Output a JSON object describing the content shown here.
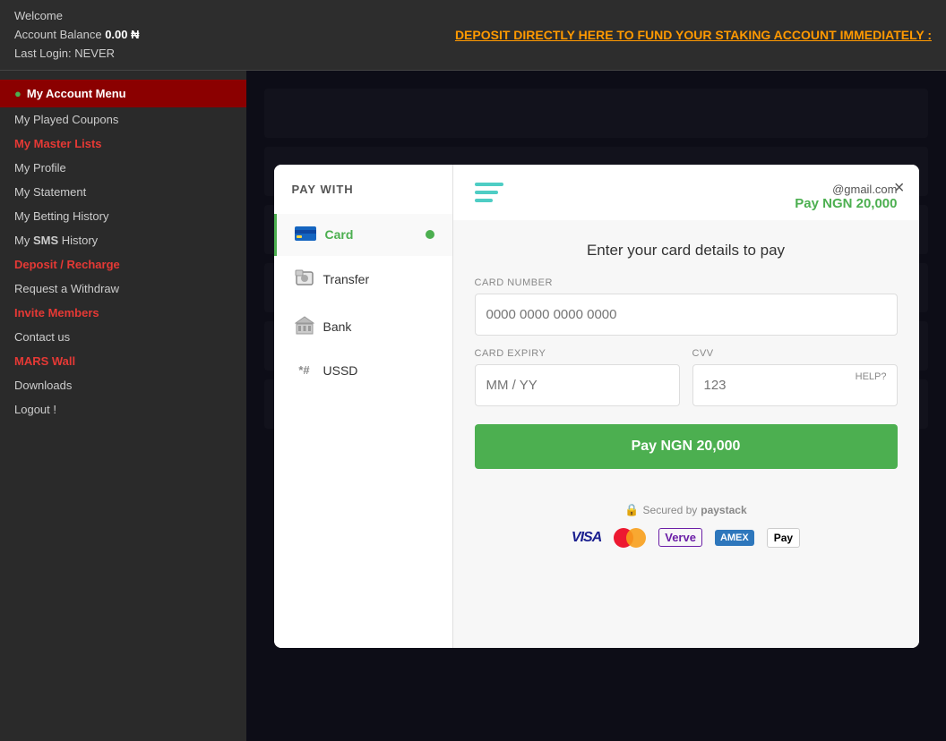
{
  "topbar": {
    "welcome": "Welcome",
    "account_balance_label": "Account Balance",
    "balance": "0.00 ₦",
    "last_login_label": "Last Login:",
    "last_login": "NEVER",
    "deposit_notice": "DEPOSIT DIRECTLY HERE TO FUND YOUR STAKING ACCOUNT IMMEDIATELY :"
  },
  "sidebar": {
    "menu_title": "My Account Menu",
    "items": [
      {
        "label": "My Played Coupons",
        "highlight": false
      },
      {
        "label": "My Master Lists",
        "highlight": true
      },
      {
        "label": "My Profile",
        "highlight": false
      },
      {
        "label": "My Statement",
        "highlight": false
      },
      {
        "label": "My Betting History",
        "highlight": false
      },
      {
        "label": "My SMS History",
        "highlight": false
      },
      {
        "label": "Deposit / Recharge",
        "highlight": true
      },
      {
        "label": "Request a Withdraw",
        "highlight": false
      },
      {
        "label": "Invite Members",
        "highlight": true
      },
      {
        "label": "Contact us",
        "highlight": false
      },
      {
        "label": "MARS Wall",
        "highlight": true
      },
      {
        "label": "Downloads",
        "highlight": false
      },
      {
        "label": "Logout !",
        "highlight": false
      }
    ]
  },
  "modal": {
    "close_label": "×",
    "pay_with_label": "PAY WITH",
    "email": "@gmail.com",
    "pay_label": "Pay",
    "amount": "NGN 20,000",
    "form_title": "Enter your card details to pay",
    "card_number_label": "CARD NUMBER",
    "card_number_placeholder": "0000 0000 0000 0000",
    "card_expiry_label": "CARD EXPIRY",
    "card_expiry_placeholder": "MM / YY",
    "cvv_label": "CVV",
    "cvv_placeholder": "123",
    "cvv_help": "HELP?",
    "pay_button": "Pay NGN 20,000",
    "secured_text": "Secured by",
    "secured_brand": "paystack",
    "payment_methods": [
      {
        "id": "card",
        "label": "Card",
        "active": true
      },
      {
        "id": "transfer",
        "label": "Transfer",
        "active": false
      },
      {
        "id": "bank",
        "label": "Bank",
        "active": false
      },
      {
        "id": "ussd",
        "label": "USSD",
        "active": false
      }
    ]
  },
  "colors": {
    "accent_green": "#4CAF50",
    "highlight_red": "#e53935",
    "sidebar_bg": "#2a2a2a"
  }
}
